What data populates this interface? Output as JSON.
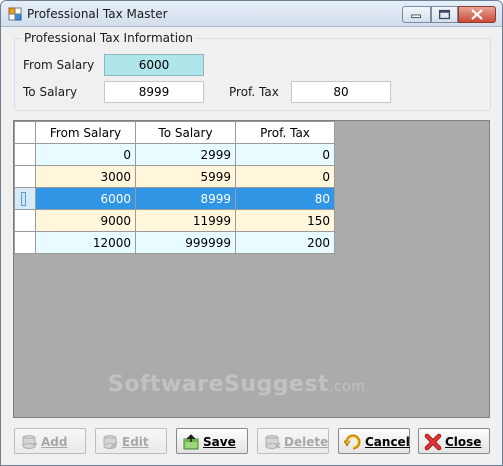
{
  "window": {
    "title": "Professional Tax Master"
  },
  "info": {
    "legend": "Professional Tax Information",
    "from_label": "From Salary",
    "from_value": "6000",
    "to_label": "To Salary",
    "to_value": "8999",
    "tax_label": "Prof. Tax",
    "tax_value": "80"
  },
  "grid": {
    "headers": [
      "From Salary",
      "To Salary",
      "Prof. Tax"
    ],
    "rows": [
      [
        "0",
        "2999",
        "0"
      ],
      [
        "3000",
        "5999",
        "0"
      ],
      [
        "6000",
        "8999",
        "80"
      ],
      [
        "9000",
        "11999",
        "150"
      ],
      [
        "12000",
        "999999",
        "200"
      ]
    ],
    "selected_row": 2
  },
  "watermark": {
    "main": "SoftwareSuggest",
    "suffix": ".com"
  },
  "buttons": {
    "add": "Add",
    "edit": "Edit",
    "save": "Save",
    "delete": "Delete",
    "cancel": "Cancel",
    "close": "Close"
  },
  "colors": {
    "accent": "#3195e6",
    "highlight_field": "#aee6ec",
    "row_odd": "#e8fbff",
    "row_even": "#fff6dc",
    "grid_bg": "#ababab"
  }
}
